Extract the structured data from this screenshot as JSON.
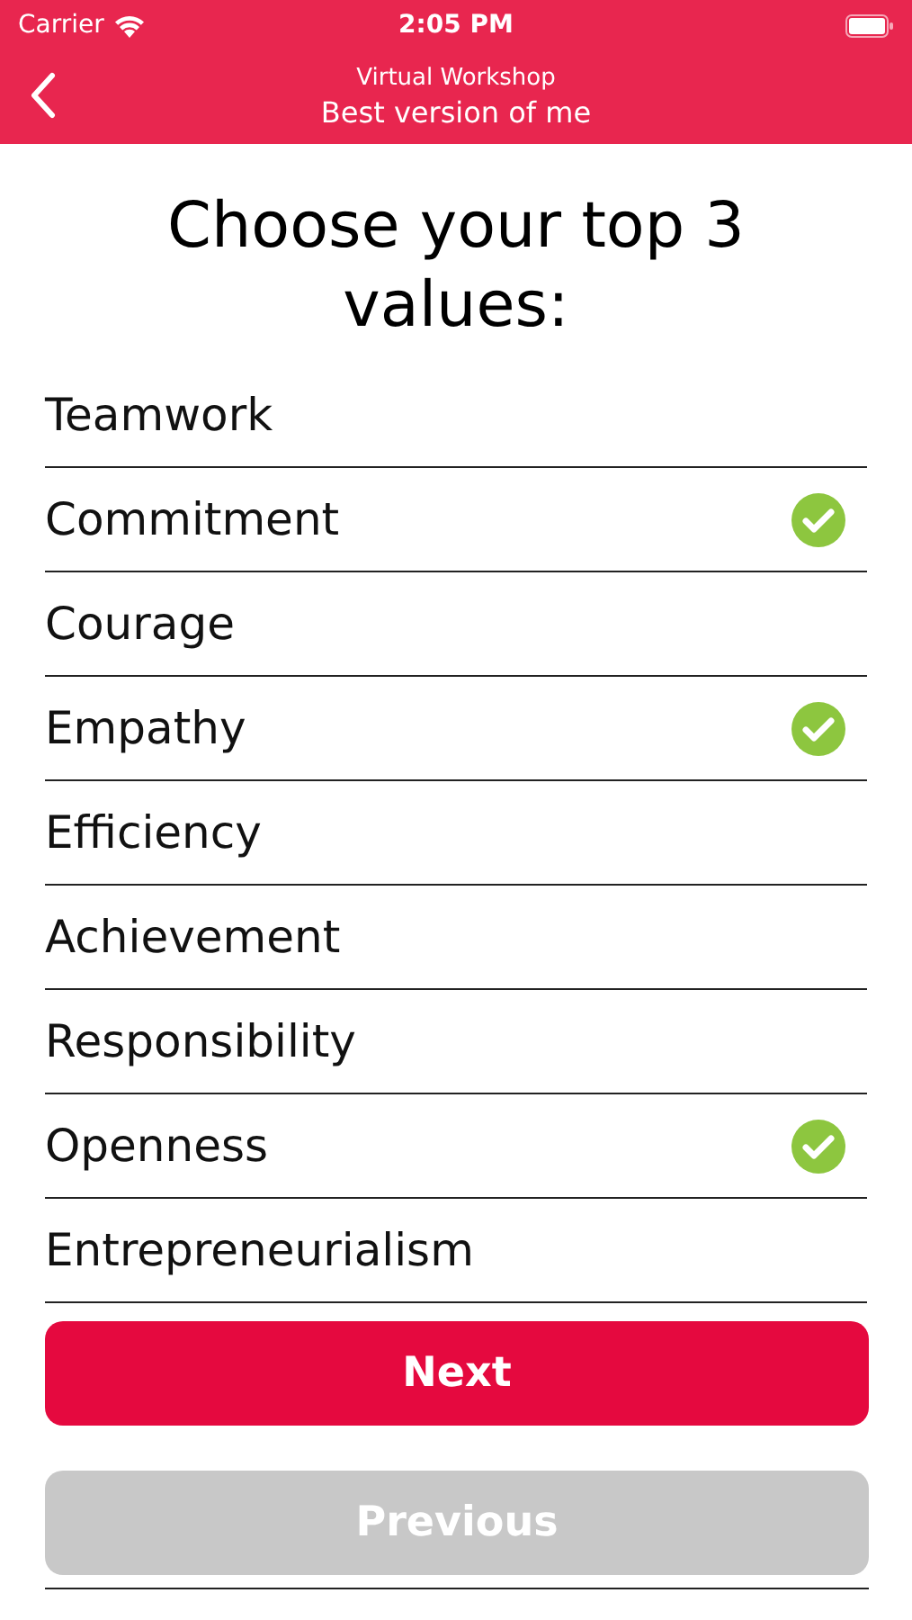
{
  "status_bar": {
    "carrier": "Carrier",
    "time": "2:05 PM"
  },
  "header": {
    "subtitle": "Virtual Workshop",
    "title": "Best version of me"
  },
  "heading": "Choose your top 3 values:",
  "values": [
    {
      "label": "Teamwork",
      "selected": false
    },
    {
      "label": "Commitment",
      "selected": true
    },
    {
      "label": "Courage",
      "selected": false
    },
    {
      "label": "Empathy",
      "selected": true
    },
    {
      "label": "Efficiency",
      "selected": false
    },
    {
      "label": "Achievement",
      "selected": false
    },
    {
      "label": "Responsibility",
      "selected": false
    },
    {
      "label": "Openness",
      "selected": true
    },
    {
      "label": "Entrepreneurialism",
      "selected": false
    }
  ],
  "buttons": [
    {
      "label": "Next",
      "disabled": false
    },
    {
      "label": "Previous",
      "disabled": true
    }
  ]
}
